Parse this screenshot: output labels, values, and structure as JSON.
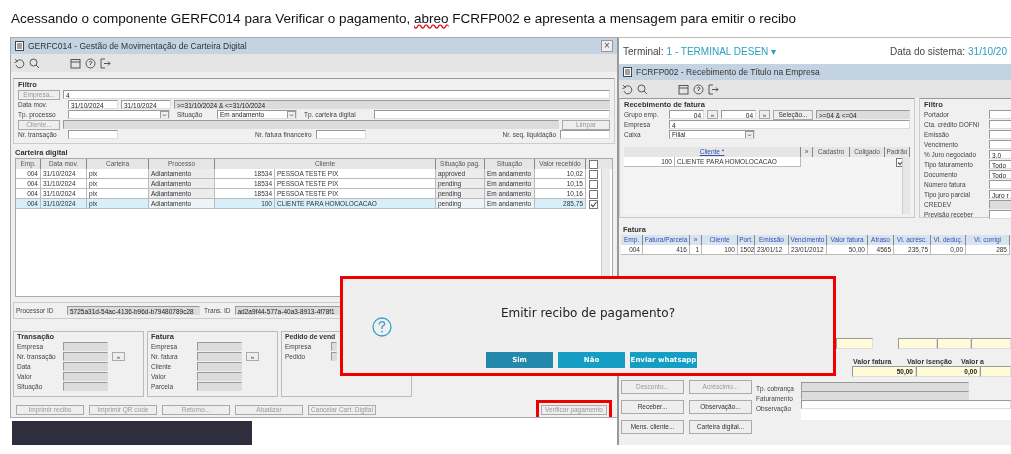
{
  "caption": {
    "before": "Acessando o componente GERFC014 para Verificar o pagamento, ",
    "misspelled": "abreo",
    "after": " FCRFP002 e apresenta a mensagem para emitir o recibo"
  },
  "left_window": {
    "title": "GERFC014 - Gestão de Movimentação de Carteira Digital",
    "close": "×",
    "filter": {
      "title": "Filtro",
      "empresa_button": "Empresa...",
      "empresa_value": "4",
      "data_mov_label": "Data mov.",
      "data_from": "31/10/2024",
      "data_to": "31/10/2024",
      "data_range": ">=31/10/2024 & <=31/10/2024",
      "tp_processo_label": "Tp. processo",
      "situacao_label": "Situação",
      "situacao_value": "Em andamento",
      "tp_carteira_label": "Tp. carteira digital",
      "cliente_button": "Cliente...",
      "limpar_button": "Limpar",
      "nr_transacao_label": "Nr. transação",
      "nr_fatura_label": "Nr. fatura financeiro",
      "nr_seq_label": "Nr. seq. liquidação"
    },
    "table": {
      "title": "Carteira digital",
      "columns": [
        "Emp.",
        "Data mov.",
        "Carteira",
        "Processo",
        "Cliente",
        "Situação pag.",
        "Situação",
        "Valor recebido"
      ],
      "header_checked": false,
      "rows": [
        {
          "emp": "004",
          "data": "31/10/2024",
          "carteira": "pix",
          "processo": "Adiantamento",
          "cliente_code": "18534",
          "cliente_name": "PESSOA TESTE PIX",
          "situacao_pag": "approved",
          "situacao": "Em andamento",
          "valor": "10,02",
          "checked": false,
          "selected": false
        },
        {
          "emp": "004",
          "data": "31/10/2024",
          "carteira": "pix",
          "processo": "Adiantamento",
          "cliente_code": "18534",
          "cliente_name": "PESSOA TESTE PIX",
          "situacao_pag": "pending",
          "situacao": "Em andamento",
          "valor": "10,15",
          "checked": false,
          "selected": false
        },
        {
          "emp": "004",
          "data": "31/10/2024",
          "carteira": "pix",
          "processo": "Adiantamento",
          "cliente_code": "18534",
          "cliente_name": "PESSOA TESTE PIX",
          "situacao_pag": "pending",
          "situacao": "Em andamento",
          "valor": "10,16",
          "checked": false,
          "selected": false
        },
        {
          "emp": "004",
          "data": "31/10/2024",
          "carteira": "pix",
          "processo": "Adiantamento",
          "cliente_code": "100",
          "cliente_name": "CLIENTE PARA HOMOLOCACAO",
          "situacao_pag": "pending",
          "situacao": "Em andamento",
          "valor": "285,75",
          "checked": true,
          "selected": true
        }
      ]
    },
    "processor_id_label": "Processor ID",
    "processor_id": "5725a31d-54ac-4136-b96d-b79480789c28",
    "trans_id_label": "Trans. ID",
    "trans_id": "ad2a9f44-577a-40a3-8913-4f78f1",
    "groups": [
      {
        "title": "Transação",
        "fields": [
          {
            "label": "Empresa"
          },
          {
            "label": "Nr. transação",
            "lookup": "»"
          },
          {
            "label": "Data"
          },
          {
            "label": "Valor"
          },
          {
            "label": "Situação"
          }
        ]
      },
      {
        "title": "Fatura",
        "fields": [
          {
            "label": "Empresa"
          },
          {
            "label": "Nr. fatura",
            "lookup": "»"
          },
          {
            "label": "Cliente"
          },
          {
            "label": "Valor"
          },
          {
            "label": "Parcela"
          }
        ]
      },
      {
        "title": "Pedido de vend",
        "fields": [
          {
            "label": "Empresa"
          },
          {
            "label": "Pedido"
          }
        ]
      }
    ],
    "buttons": [
      {
        "label": "Imprimir recibo",
        "disabled": true,
        "highlighted": false
      },
      {
        "label": "Imprimir QR code",
        "disabled": true,
        "highlighted": false
      },
      {
        "label": "Retorno...",
        "disabled": true,
        "highlighted": false
      },
      {
        "label": "Atualizar",
        "disabled": true,
        "highlighted": false
      },
      {
        "label": "Cancelar Cart. Digital",
        "disabled": true,
        "highlighted": false
      },
      {
        "label": "Verificar pagamento",
        "disabled": true,
        "highlighted": true
      }
    ]
  },
  "right_window": {
    "terminal_label": "Terminal:",
    "terminal_value": "1 - TERMINAL DESEN ▾",
    "date_label": "Data do sistema:",
    "date_value": "31/10/20",
    "title": "FCRFP002 - Recebimento de Título na Empresa",
    "receb": {
      "title": "Recebimento de fatura",
      "grupo_label": "Grupo emp.",
      "grupo_from": "04",
      "grupo_to": "04",
      "lookup": "»",
      "selecao_button": "Seleção...",
      "grupo_range": ">=04 & <=04",
      "empresa_label": "Empresa",
      "empresa_value": "4",
      "caixa_label": "Caixa",
      "caixa_value": "Filial",
      "columns": [
        "Cliente *",
        "»",
        "Cadastro",
        "Coligado",
        "Padrão"
      ],
      "rows": [
        {
          "code": "100",
          "name": "CLIENTE PARA HOMOLOCACAO",
          "padrao": true
        }
      ]
    },
    "filtro": {
      "title": "Filtro",
      "fields": [
        {
          "label": "Portador",
          "kind": "text"
        },
        {
          "label": "Cta. crédito DOFNI",
          "kind": "text"
        },
        {
          "label": "Emissão",
          "kind": "text"
        },
        {
          "label": "Vencimento",
          "kind": "text"
        },
        {
          "label": "% Juro negociado",
          "value": "3,0",
          "kind": "text"
        },
        {
          "label": "Tipo faturamento",
          "value": "Todo",
          "kind": "text"
        },
        {
          "label": "Documento",
          "value": "Todo",
          "kind": "text"
        },
        {
          "label": "Número fatura",
          "kind": "text"
        },
        {
          "label": "Tipo juro parcial",
          "value": "Juro r",
          "kind": "text"
        },
        {
          "label": "CREDEV",
          "kind": "readonly"
        },
        {
          "label": "Previsão receber",
          "kind": "text"
        }
      ]
    },
    "fatura": {
      "title": "Fatura",
      "columns": [
        "Emp.",
        "Fatura/Parcela",
        "»",
        "Cliente",
        "Port.",
        "Emissão",
        "Vencimento",
        "Valor fatura",
        "Atraso",
        "Vl. acrésc.",
        "Vl. deduç.",
        "Vl. corrigi"
      ],
      "rows": [
        [
          "004",
          "416",
          "1",
          "100",
          "1502",
          "23/01/12",
          "23/01/2012",
          "50,00",
          "4565",
          "235,75",
          "0,00",
          "285"
        ]
      ]
    },
    "totals": {
      "columns": [
        "Valor fatura",
        "Valor isenção",
        "Valor a"
      ],
      "values": [
        "50,00",
        "0,00"
      ]
    },
    "buttons": [
      {
        "label": "Desconto...",
        "disabled": true
      },
      {
        "label": "Acréscimo...",
        "disabled": true
      },
      {
        "label": "Receber...",
        "disabled": false
      },
      {
        "label": "Observação...",
        "disabled": false
      },
      {
        "label": "Mens. cliente...",
        "disabled": false
      },
      {
        "label": "Carteira digital...",
        "disabled": false
      }
    ],
    "info_labels": [
      "Tp. cobrança",
      "Faturamento",
      "Observação"
    ]
  },
  "dialog": {
    "message": "Emitir recibo de pagamento?",
    "buttons": [
      {
        "label": "Sim",
        "selected": true
      },
      {
        "label": "Não",
        "selected": false
      },
      {
        "label": "Enviar whatsapp",
        "selected": false
      }
    ]
  }
}
